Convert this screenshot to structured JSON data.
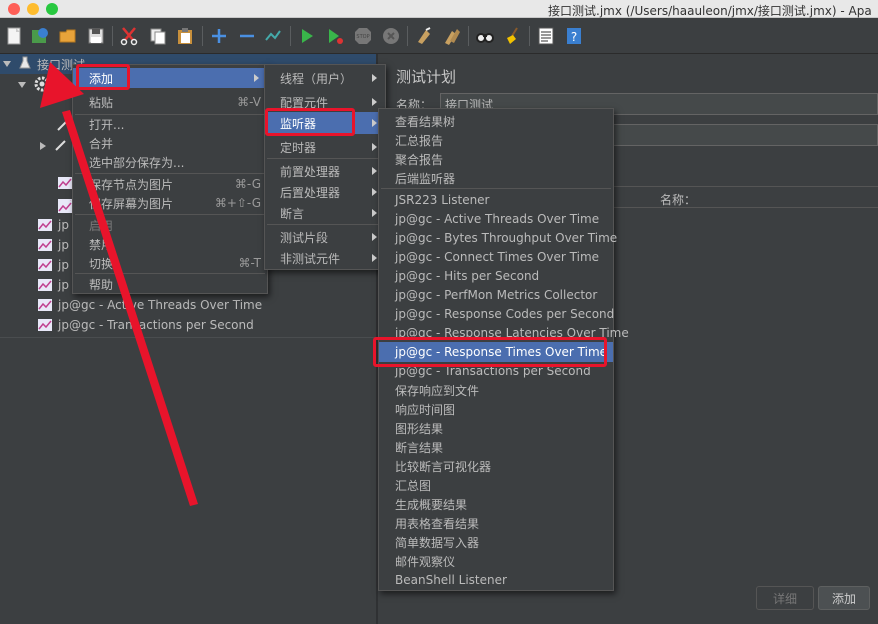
{
  "window": {
    "title": "接口测试.jmx (/Users/haauleon/jmx/接口测试.jmx) - Apa"
  },
  "toolbar": {
    "icons": [
      "new-icon",
      "templates-icon",
      "open-icon",
      "save-icon",
      "cut-icon",
      "copy-icon",
      "paste-icon",
      "expand-icon",
      "collapse-icon",
      "toggle-icon",
      "start-icon",
      "start-no-pause-icon",
      "stop-icon",
      "shutdown-icon",
      "clear-icon",
      "clear-all-icon",
      "search-icon",
      "broom-icon",
      "function-helper-icon",
      "help-icon"
    ]
  },
  "tree": {
    "root": "接口测试",
    "items": [
      "jp@gc - Active Threads Over Time",
      "jp@gc - Transactions per Second"
    ],
    "partial_items": [
      "jp",
      "jp",
      "jp",
      "jp"
    ]
  },
  "context_menu": {
    "items": [
      {
        "label": "添加",
        "shortcut": ""
      },
      {
        "label": "粘贴",
        "shortcut": "⌘-V"
      },
      {
        "label": "打开...",
        "shortcut": ""
      },
      {
        "label": "合并",
        "shortcut": ""
      },
      {
        "label": "选中部分保存为...",
        "shortcut": ""
      },
      {
        "label": "保存节点为图片",
        "shortcut": "⌘-G"
      },
      {
        "label": "保存屏幕为图片",
        "shortcut": "⌘+⇧-G"
      },
      {
        "label": "启用",
        "shortcut": ""
      },
      {
        "label": "禁用",
        "shortcut": ""
      },
      {
        "label": "切换",
        "shortcut": "⌘-T"
      },
      {
        "label": "帮助",
        "shortcut": ""
      }
    ]
  },
  "add_menu": {
    "items": [
      "线程（用户）",
      "配置元件",
      "监听器",
      "定时器",
      "前置处理器",
      "后置处理器",
      "断言",
      "测试片段",
      "非测试元件"
    ]
  },
  "listener_menu": {
    "items": [
      "查看结果树",
      "汇总报告",
      "聚合报告",
      "后端监听器",
      "JSR223 Listener",
      "jp@gc - Active Threads Over Time",
      "jp@gc - Bytes Throughput Over Time",
      "jp@gc - Connect Times Over Time",
      "jp@gc - Hits per Second",
      "jp@gc - PerfMon Metrics Collector",
      "jp@gc - Response Codes per Second",
      "jp@gc - Response Latencies Over Time",
      "jp@gc - Response Times Over Time",
      "jp@gc - Transactions per Second",
      "保存响应到文件",
      "响应时间图",
      "图形结果",
      "断言结果",
      "比较断言可视化器",
      "汇总图",
      "生成概要结果",
      "用表格查看结果",
      "简单数据写入器",
      "邮件观察仪",
      "BeanShell Listener"
    ]
  },
  "right_panel": {
    "title": "测试计划",
    "name_label": "名称：",
    "name_value": "接口测试",
    "table_name_header": "名称：",
    "detail_button": "详细",
    "add_button": "添加"
  },
  "colors": {
    "background": "#3c3f41",
    "highlight": "#4b6eaf",
    "annotation": "#e8142b"
  }
}
